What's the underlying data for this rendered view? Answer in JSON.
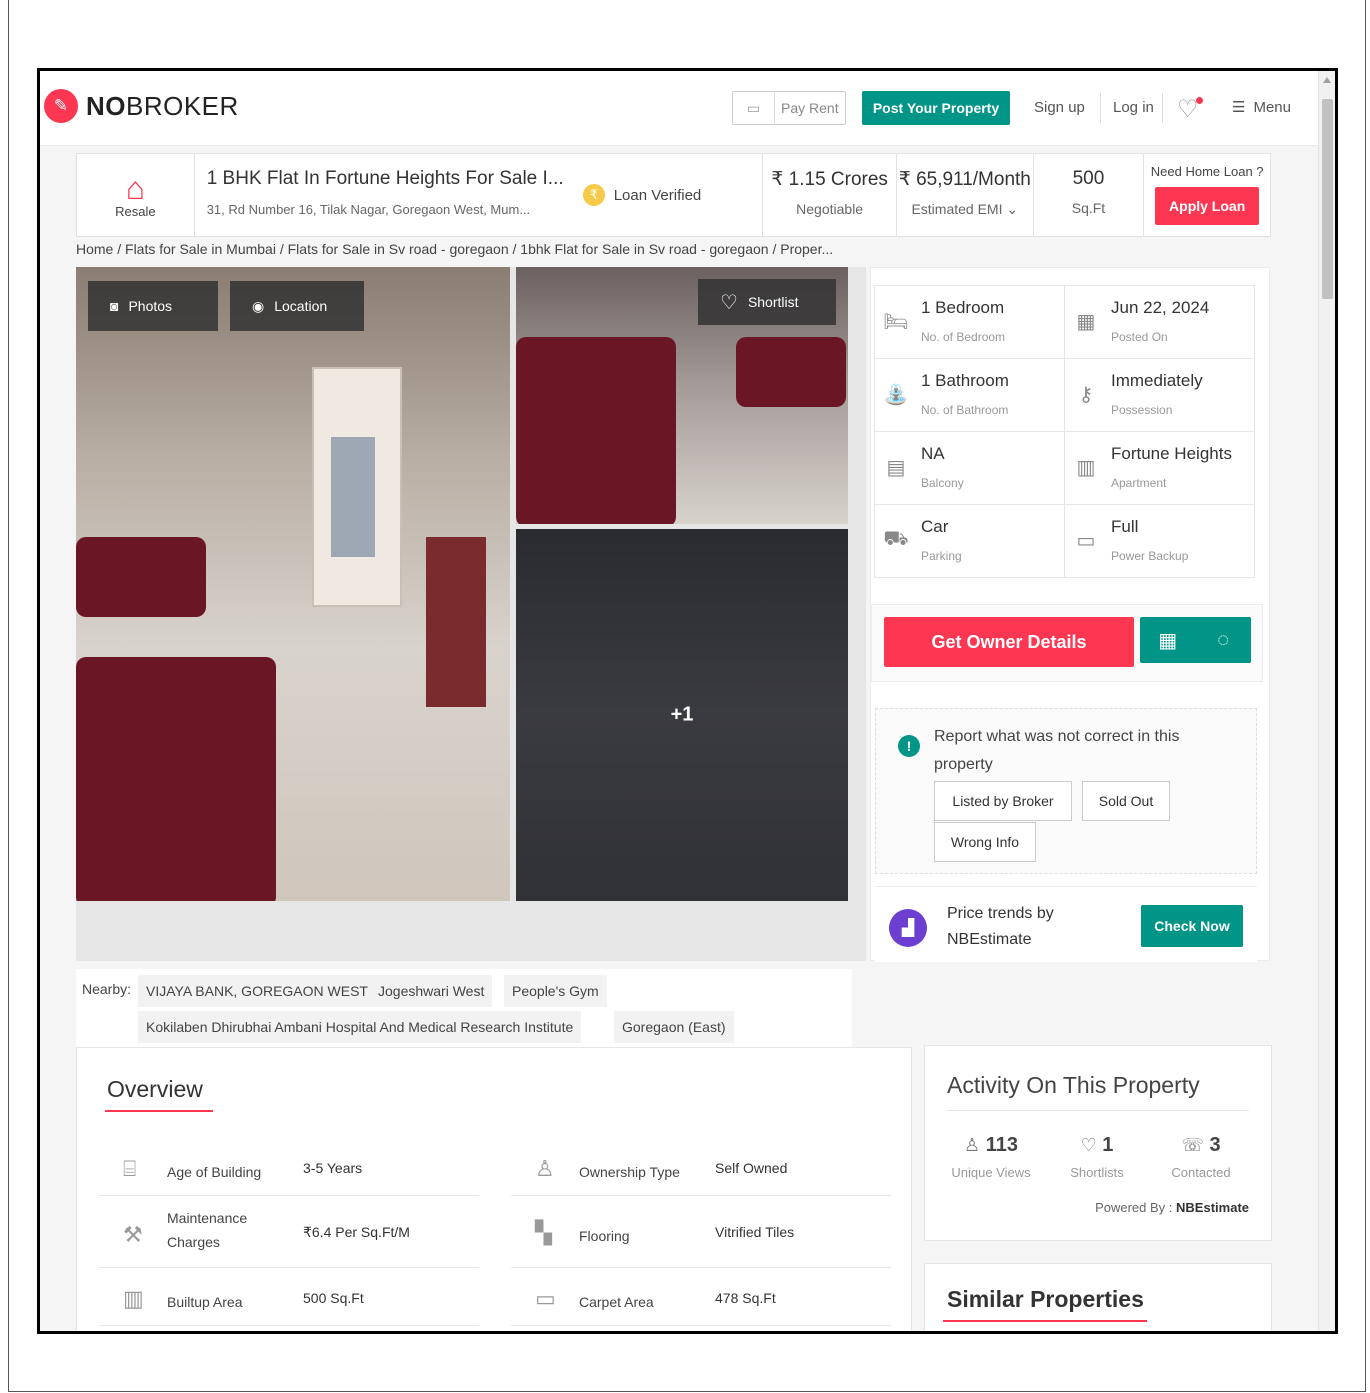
{
  "brand": {
    "name_bold": "NO",
    "name_light": "BROKER"
  },
  "nav": {
    "pay_rent": "Pay Rent",
    "post_property": "Post Your Property",
    "sign_up": "Sign up",
    "log_in": "Log in",
    "menu": "Menu"
  },
  "summary": {
    "type_label": "Resale",
    "title": "1 BHK Flat In Fortune Heights For Sale I...",
    "address": "31, Rd Number 16, Tilak Nagar, Goregaon West, Mum...",
    "loan_verified": "Loan Verified",
    "price": "₹ 1.15 Crores",
    "price_sub": "Negotiable",
    "emi": "₹ 65,911/Month",
    "emi_sub": "Estimated EMI",
    "area": "500",
    "area_sub": "Sq.Ft",
    "loan_question": "Need Home Loan ?",
    "apply_loan": "Apply Loan"
  },
  "breadcrumb": "Home / Flats for Sale in Mumbai / Flats for Sale in Sv road - goregaon / 1bhk Flat for Sale in Sv road - goregaon / Proper...",
  "gallery": {
    "photos_btn": "Photos",
    "location_btn": "Location",
    "shortlist_btn": "Shortlist",
    "more_count": "+1"
  },
  "specs": [
    {
      "value": "1 Bedroom",
      "label": "No. of Bedroom",
      "icon": "bed-icon"
    },
    {
      "value": "Jun 22, 2024",
      "label": "Posted On",
      "icon": "calendar-icon"
    },
    {
      "value": "1 Bathroom",
      "label": "No. of Bathroom",
      "icon": "bathtub-icon"
    },
    {
      "value": "Immediately",
      "label": "Possession",
      "icon": "key-icon"
    },
    {
      "value": "NA",
      "label": "Balcony",
      "icon": "balcony-icon"
    },
    {
      "value": "Fortune Heights",
      "label": "Apartment",
      "icon": "building-icon"
    },
    {
      "value": "Car",
      "label": "Parking",
      "icon": "car-icon"
    },
    {
      "value": "Full",
      "label": "Power Backup",
      "icon": "battery-icon"
    }
  ],
  "owner": {
    "cta": "Get Owner Details"
  },
  "report": {
    "text": "Report what was not correct in this property",
    "options": [
      "Listed by Broker",
      "Sold Out",
      "Wrong Info"
    ]
  },
  "trends": {
    "line1": "Price trends by",
    "line2": "NBEstimate",
    "cta": "Check Now"
  },
  "nearby": {
    "label": "Nearby:",
    "places": [
      "VIJAYA BANK, GOREGAON WEST",
      "Jogeshwari West",
      "People's Gym",
      "Kokilaben Dhirubhai Ambani Hospital And Medical Research Institute",
      "Goregaon (East)"
    ]
  },
  "overview": {
    "title": "Overview",
    "rows": [
      {
        "key": "Age of Building",
        "value": "3-5 Years",
        "icon": "building-age-icon"
      },
      {
        "key": "Ownership Type",
        "value": "Self Owned",
        "icon": "ownership-icon"
      },
      {
        "key": "Maintenance Charges",
        "value": "₹6.4 Per Sq.Ft/M",
        "icon": "maintenance-icon"
      },
      {
        "key": "Flooring",
        "value": "Vitrified Tiles",
        "icon": "flooring-icon"
      },
      {
        "key": "Builtup Area",
        "value": "500 Sq.Ft",
        "icon": "builtup-icon"
      },
      {
        "key": "Carpet Area",
        "value": "478 Sq.Ft",
        "icon": "carpet-icon"
      }
    ]
  },
  "activity": {
    "title": "Activity On This Property",
    "items": [
      {
        "count": "113",
        "label": "Unique Views",
        "icon": "user-icon"
      },
      {
        "count": "1",
        "label": "Shortlists",
        "icon": "heart-icon"
      },
      {
        "count": "3",
        "label": "Contacted",
        "icon": "phone-icon"
      }
    ],
    "powered_label": "Powered By :",
    "powered_name": "NBEstimate"
  },
  "similar": {
    "title": "Similar Properties"
  }
}
